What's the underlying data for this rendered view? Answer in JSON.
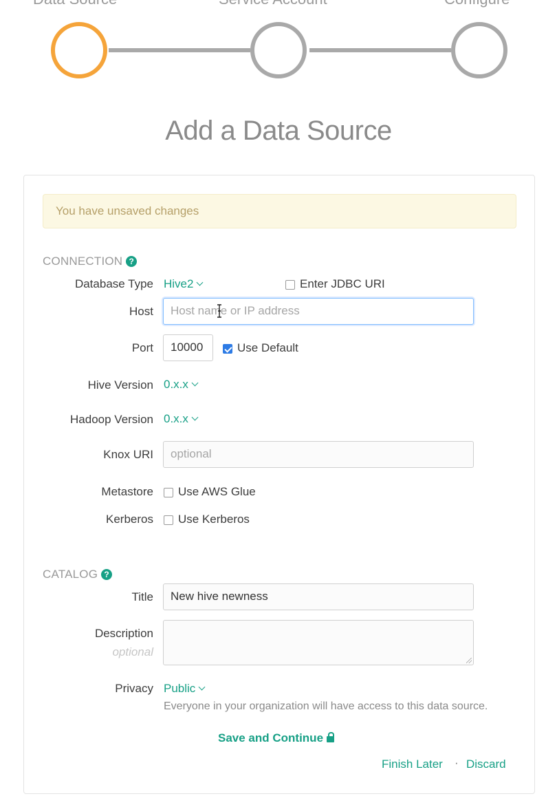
{
  "stepper": {
    "steps": [
      {
        "label": "Data Source",
        "active": true
      },
      {
        "label": "Service Account",
        "active": false
      },
      {
        "label": "Configure",
        "active": false
      }
    ],
    "active_color": "#f5a43a",
    "inactive_color": "#a9a9a9"
  },
  "page_title": "Add a Data Source",
  "alert": {
    "text": "You have unsaved changes"
  },
  "connection": {
    "heading": "CONNECTION",
    "help_icon": "question-circle-icon",
    "database_type": {
      "label": "Database Type",
      "value": "Hive2"
    },
    "jdbc": {
      "label": "Enter JDBC URI",
      "checked": false
    },
    "host": {
      "label": "Host",
      "value": "",
      "placeholder": "Host name or IP address"
    },
    "port": {
      "label": "Port",
      "value": "10000"
    },
    "use_default": {
      "label": "Use Default",
      "checked": true
    },
    "hive_version": {
      "label": "Hive Version",
      "value": "0.x.x"
    },
    "hadoop_version": {
      "label": "Hadoop Version",
      "value": "0.x.x"
    },
    "knox_uri": {
      "label": "Knox URI",
      "placeholder": "optional"
    },
    "metastore": {
      "label": "Metastore",
      "option": "Use AWS Glue",
      "checked": false
    },
    "kerberos": {
      "label": "Kerberos",
      "option": "Use Kerberos",
      "checked": false
    }
  },
  "catalog": {
    "heading": "CATALOG",
    "help_icon": "question-circle-icon",
    "title": {
      "label": "Title",
      "value": "New hive newness"
    },
    "description": {
      "label": "Description",
      "hint": "optional",
      "value": ""
    },
    "privacy": {
      "label": "Privacy",
      "value": "Public",
      "note": "Everyone in your organization will have access to this data source."
    }
  },
  "actions": {
    "save": "Save and Continue",
    "finish_later": "Finish Later",
    "separator": "·",
    "discard": "Discard"
  },
  "accent_color": "#17a086"
}
